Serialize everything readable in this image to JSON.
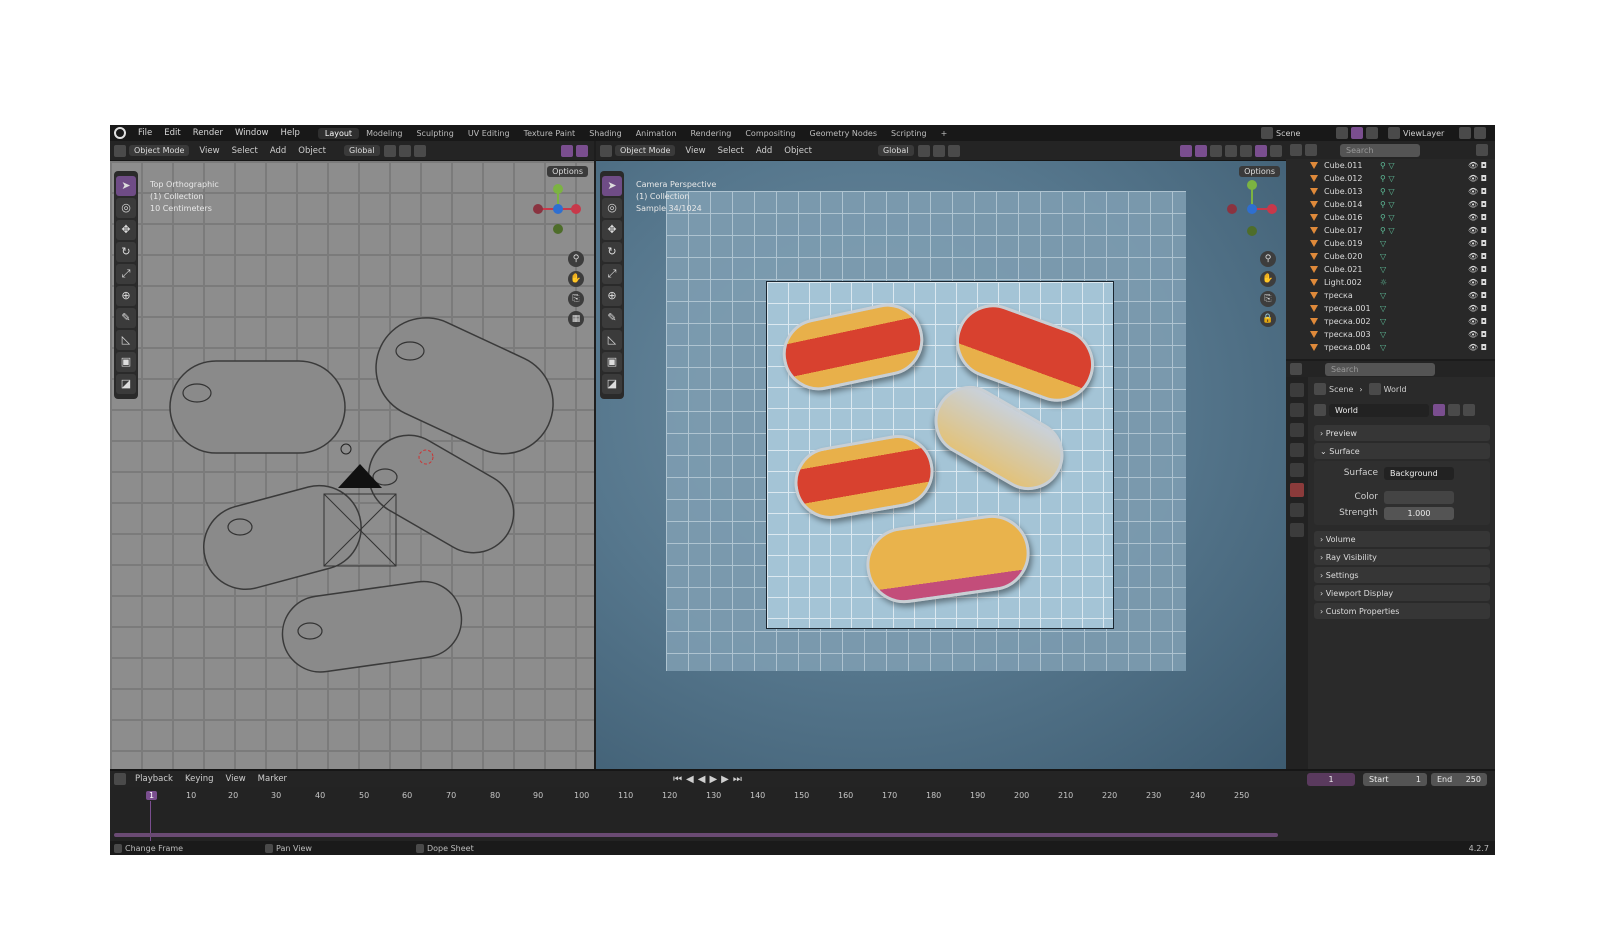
{
  "topbar": {
    "menu": [
      "File",
      "Edit",
      "Render",
      "Window",
      "Help"
    ],
    "workspaces": [
      "Layout",
      "Modeling",
      "Sculpting",
      "UV Editing",
      "Texture Paint",
      "Shading",
      "Animation",
      "Rendering",
      "Compositing",
      "Geometry Nodes",
      "Scripting",
      "+"
    ],
    "active_workspace": "Layout",
    "scene": "Scene",
    "view_layer": "ViewLayer"
  },
  "left_view": {
    "mode": "Object Mode",
    "menus": [
      "View",
      "Select",
      "Add",
      "Object"
    ],
    "orientation": "Global",
    "options": "Options",
    "overlay": [
      "Top Orthographic",
      "(1) Collection",
      "10 Centimeters"
    ]
  },
  "right_view": {
    "mode": "Object Mode",
    "menus": [
      "View",
      "Select",
      "Add",
      "Object"
    ],
    "orientation": "Global",
    "options": "Options",
    "overlay": [
      "Camera Perspective",
      "(1) Collection",
      "Sample 34/1024"
    ]
  },
  "outliner": {
    "search_placeholder": "Search",
    "items": [
      "Cube.011",
      "Cube.012",
      "Cube.013",
      "Cube.014",
      "Cube.016",
      "Cube.017",
      "Cube.019",
      "Cube.020",
      "Cube.021",
      "Light.002",
      "треска",
      "треска.001",
      "треска.002",
      "треска.003",
      "треска.004"
    ]
  },
  "properties": {
    "search_placeholder": "Search",
    "breadcrumb": [
      "Scene",
      "World"
    ],
    "world_name": "World",
    "panels_top": [
      "Preview",
      "Surface"
    ],
    "surface_label": "Surface",
    "surface_value": "Background",
    "color_label": "Color",
    "strength_label": "Strength",
    "strength_value": "1.000",
    "panels_bottom": [
      "Volume",
      "Ray Visibility",
      "Settings",
      "Viewport Display",
      "Custom Properties"
    ]
  },
  "timeline": {
    "menus": [
      "Playback",
      "Keying",
      "View",
      "Marker"
    ],
    "current_frame": "1",
    "start_label": "Start",
    "start_value": "1",
    "end_label": "End",
    "end_value": "250",
    "ticks": [
      "1",
      "10",
      "20",
      "30",
      "40",
      "50",
      "60",
      "70",
      "80",
      "90",
      "100",
      "110",
      "120",
      "130",
      "140",
      "150",
      "160",
      "170",
      "180",
      "190",
      "200",
      "210",
      "220",
      "230",
      "240",
      "250"
    ]
  },
  "status": {
    "items": [
      "Change Frame",
      "Pan View",
      "Dope Sheet"
    ],
    "version": "4.2.7"
  },
  "colors": {
    "accent": "#7a4e8f",
    "can_red": "#d8412f",
    "can_yellow": "#e8b04a",
    "axis_x": "#c8384a",
    "axis_y": "#7cb342",
    "axis_z": "#2e6fd0"
  }
}
